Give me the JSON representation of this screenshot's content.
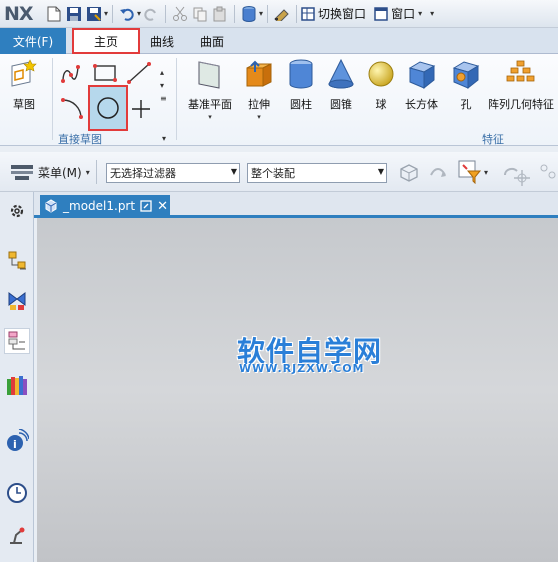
{
  "app": {
    "logo": "NX"
  },
  "qat": {
    "switch_window": "切换窗口",
    "window_menu": "窗口"
  },
  "tabs": {
    "file": "文件(F)",
    "home": "主页",
    "curve": "曲线",
    "surface": "曲面"
  },
  "ribbon": {
    "sketch": "草图",
    "direct_sketch_group": "直接草图",
    "features_group": "特征",
    "datum_plane": "基准平面",
    "extrude": "拉伸",
    "cylinder": "圆柱",
    "cone": "圆锥",
    "sphere": "球",
    "block": "长方体",
    "hole": "孔",
    "pattern_feature": "阵列几何特征"
  },
  "selection_bar": {
    "menu": "菜单(M)",
    "filter_value": "无选择过滤器",
    "assembly_value": "整个装配"
  },
  "document": {
    "tab_name": "_model1.prt"
  },
  "watermark": {
    "title": "软件自学网",
    "url": "WWW.RJZXW.COM"
  },
  "colors": {
    "accent": "#2f7fbf",
    "highlight": "#e23b3b",
    "watermark": "#2a7fd8"
  }
}
